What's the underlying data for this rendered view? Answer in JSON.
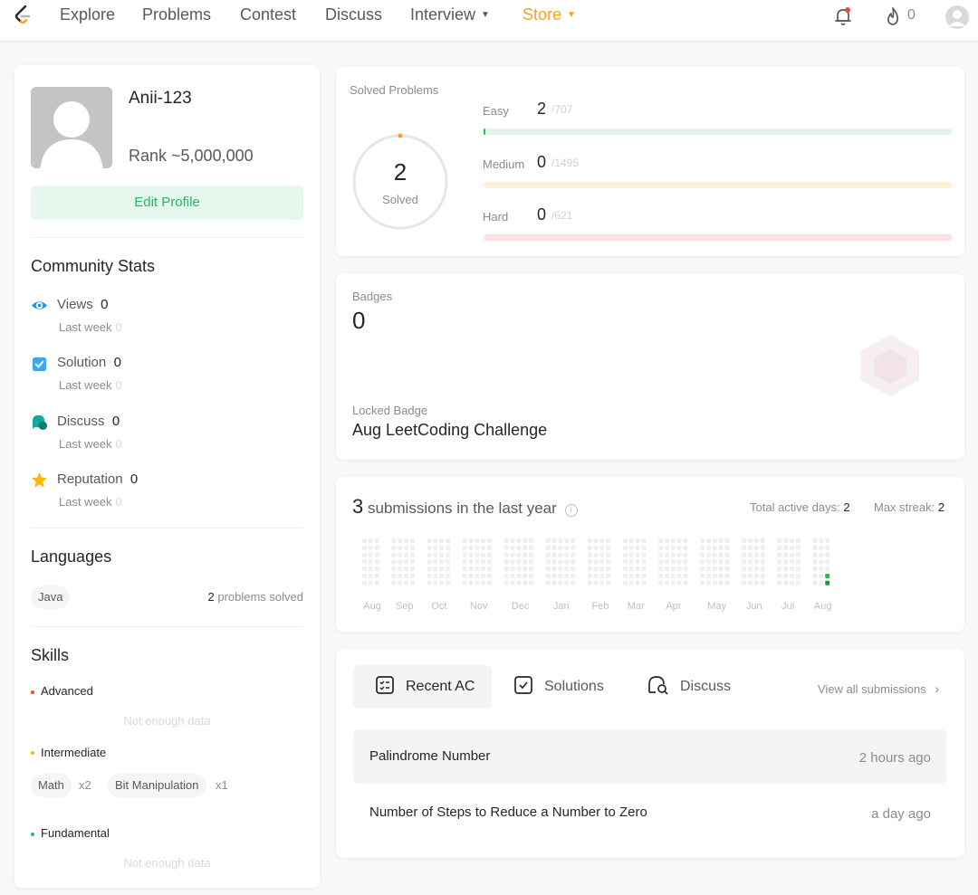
{
  "nav": {
    "items": [
      "Explore",
      "Problems",
      "Contest",
      "Discuss",
      "Interview",
      "Store"
    ],
    "fire_count": "0",
    "accent_color": "#ffa116"
  },
  "profile": {
    "username": "Anii-123",
    "rank": "Rank ~5,000,000",
    "edit_label": "Edit Profile"
  },
  "community": {
    "title": "Community Stats",
    "stats": [
      {
        "label": "Views",
        "value": "0",
        "sub": "Last week",
        "sub_value": "0",
        "icon": "eye-icon"
      },
      {
        "label": "Solution",
        "value": "0",
        "sub": "Last week",
        "sub_value": "0",
        "icon": "check-square-icon"
      },
      {
        "label": "Discuss",
        "value": "0",
        "sub": "Last week",
        "sub_value": "0",
        "icon": "chat-bubble-icon"
      },
      {
        "label": "Reputation",
        "value": "0",
        "sub": "Last week",
        "sub_value": "0",
        "icon": "star-icon"
      }
    ]
  },
  "languages": {
    "title": "Languages",
    "items": [
      {
        "name": "Java",
        "count": "2",
        "suffix": "problems solved"
      }
    ]
  },
  "skills": {
    "title": "Skills",
    "advanced": "Advanced",
    "advanced_empty": "Not enough data",
    "intermediate": "Intermediate",
    "intermediate_tags": [
      {
        "name": "Math",
        "count": "x2"
      },
      {
        "name": "Bit Manipulation",
        "count": "x1"
      }
    ],
    "fundamental": "Fundamental",
    "fundamental_empty": "Not enough data"
  },
  "solved": {
    "title": "Solved Problems",
    "total": "2",
    "total_label": "Solved",
    "levels": [
      {
        "label": "Easy",
        "solved": "2",
        "total": "/707",
        "fraction": 0.0028,
        "color": "#2cbb5d",
        "track": "#e3f5e9"
      },
      {
        "label": "Medium",
        "solved": "0",
        "total": "/1495",
        "fraction": 0,
        "color": "#ffb800",
        "track": "#fdf3d8"
      },
      {
        "label": "Hard",
        "solved": "0",
        "total": "/621",
        "fraction": 0,
        "color": "#ef4743",
        "track": "#fbe1e1"
      }
    ]
  },
  "badges": {
    "title": "Badges",
    "count": "0",
    "locked_label": "Locked Badge",
    "locked_name": "Aug LeetCoding Challenge"
  },
  "submissions": {
    "count": "3",
    "text": "submissions in the last year",
    "active_days_label": "Total active days:",
    "active_days": "2",
    "max_streak_label": "Max streak:",
    "max_streak": "2",
    "months": [
      "Aug",
      "Sep",
      "Oct",
      "Nov",
      "Dec",
      "Jan",
      "Feb",
      "Mar",
      "Apr",
      "May",
      "Jun",
      "Jul",
      "Aug"
    ]
  },
  "recent": {
    "tabs": [
      "Recent AC",
      "Solutions",
      "Discuss"
    ],
    "view_all": "View all submissions",
    "rows": [
      {
        "title": "Palindrome Number",
        "time": "2 hours ago"
      },
      {
        "title": "Number of Steps to Reduce a Number to Zero",
        "time": "a day ago"
      }
    ]
  }
}
